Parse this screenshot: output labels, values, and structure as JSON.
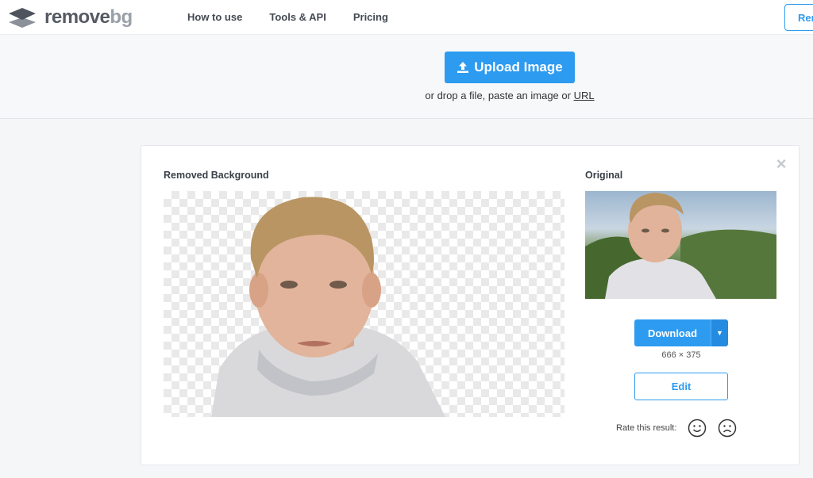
{
  "header": {
    "logo": {
      "word1": "remove",
      "word2": "bg"
    },
    "nav": [
      "How to use",
      "Tools & API",
      "Pricing"
    ],
    "button_label": "Rer"
  },
  "upload": {
    "button_label": "Upload Image",
    "hint_text": "or drop a file, paste an image or ",
    "hint_link": "URL"
  },
  "result": {
    "removed_title": "Removed Background",
    "original_title": "Original",
    "download_label": "Download",
    "dimensions": "666 × 375",
    "edit_label": "Edit",
    "rate_label": "Rate this result:"
  },
  "colors": {
    "accent": "#2d9bf0",
    "header_bg": "#ffffff",
    "page_bg": "#f5f6f8"
  }
}
